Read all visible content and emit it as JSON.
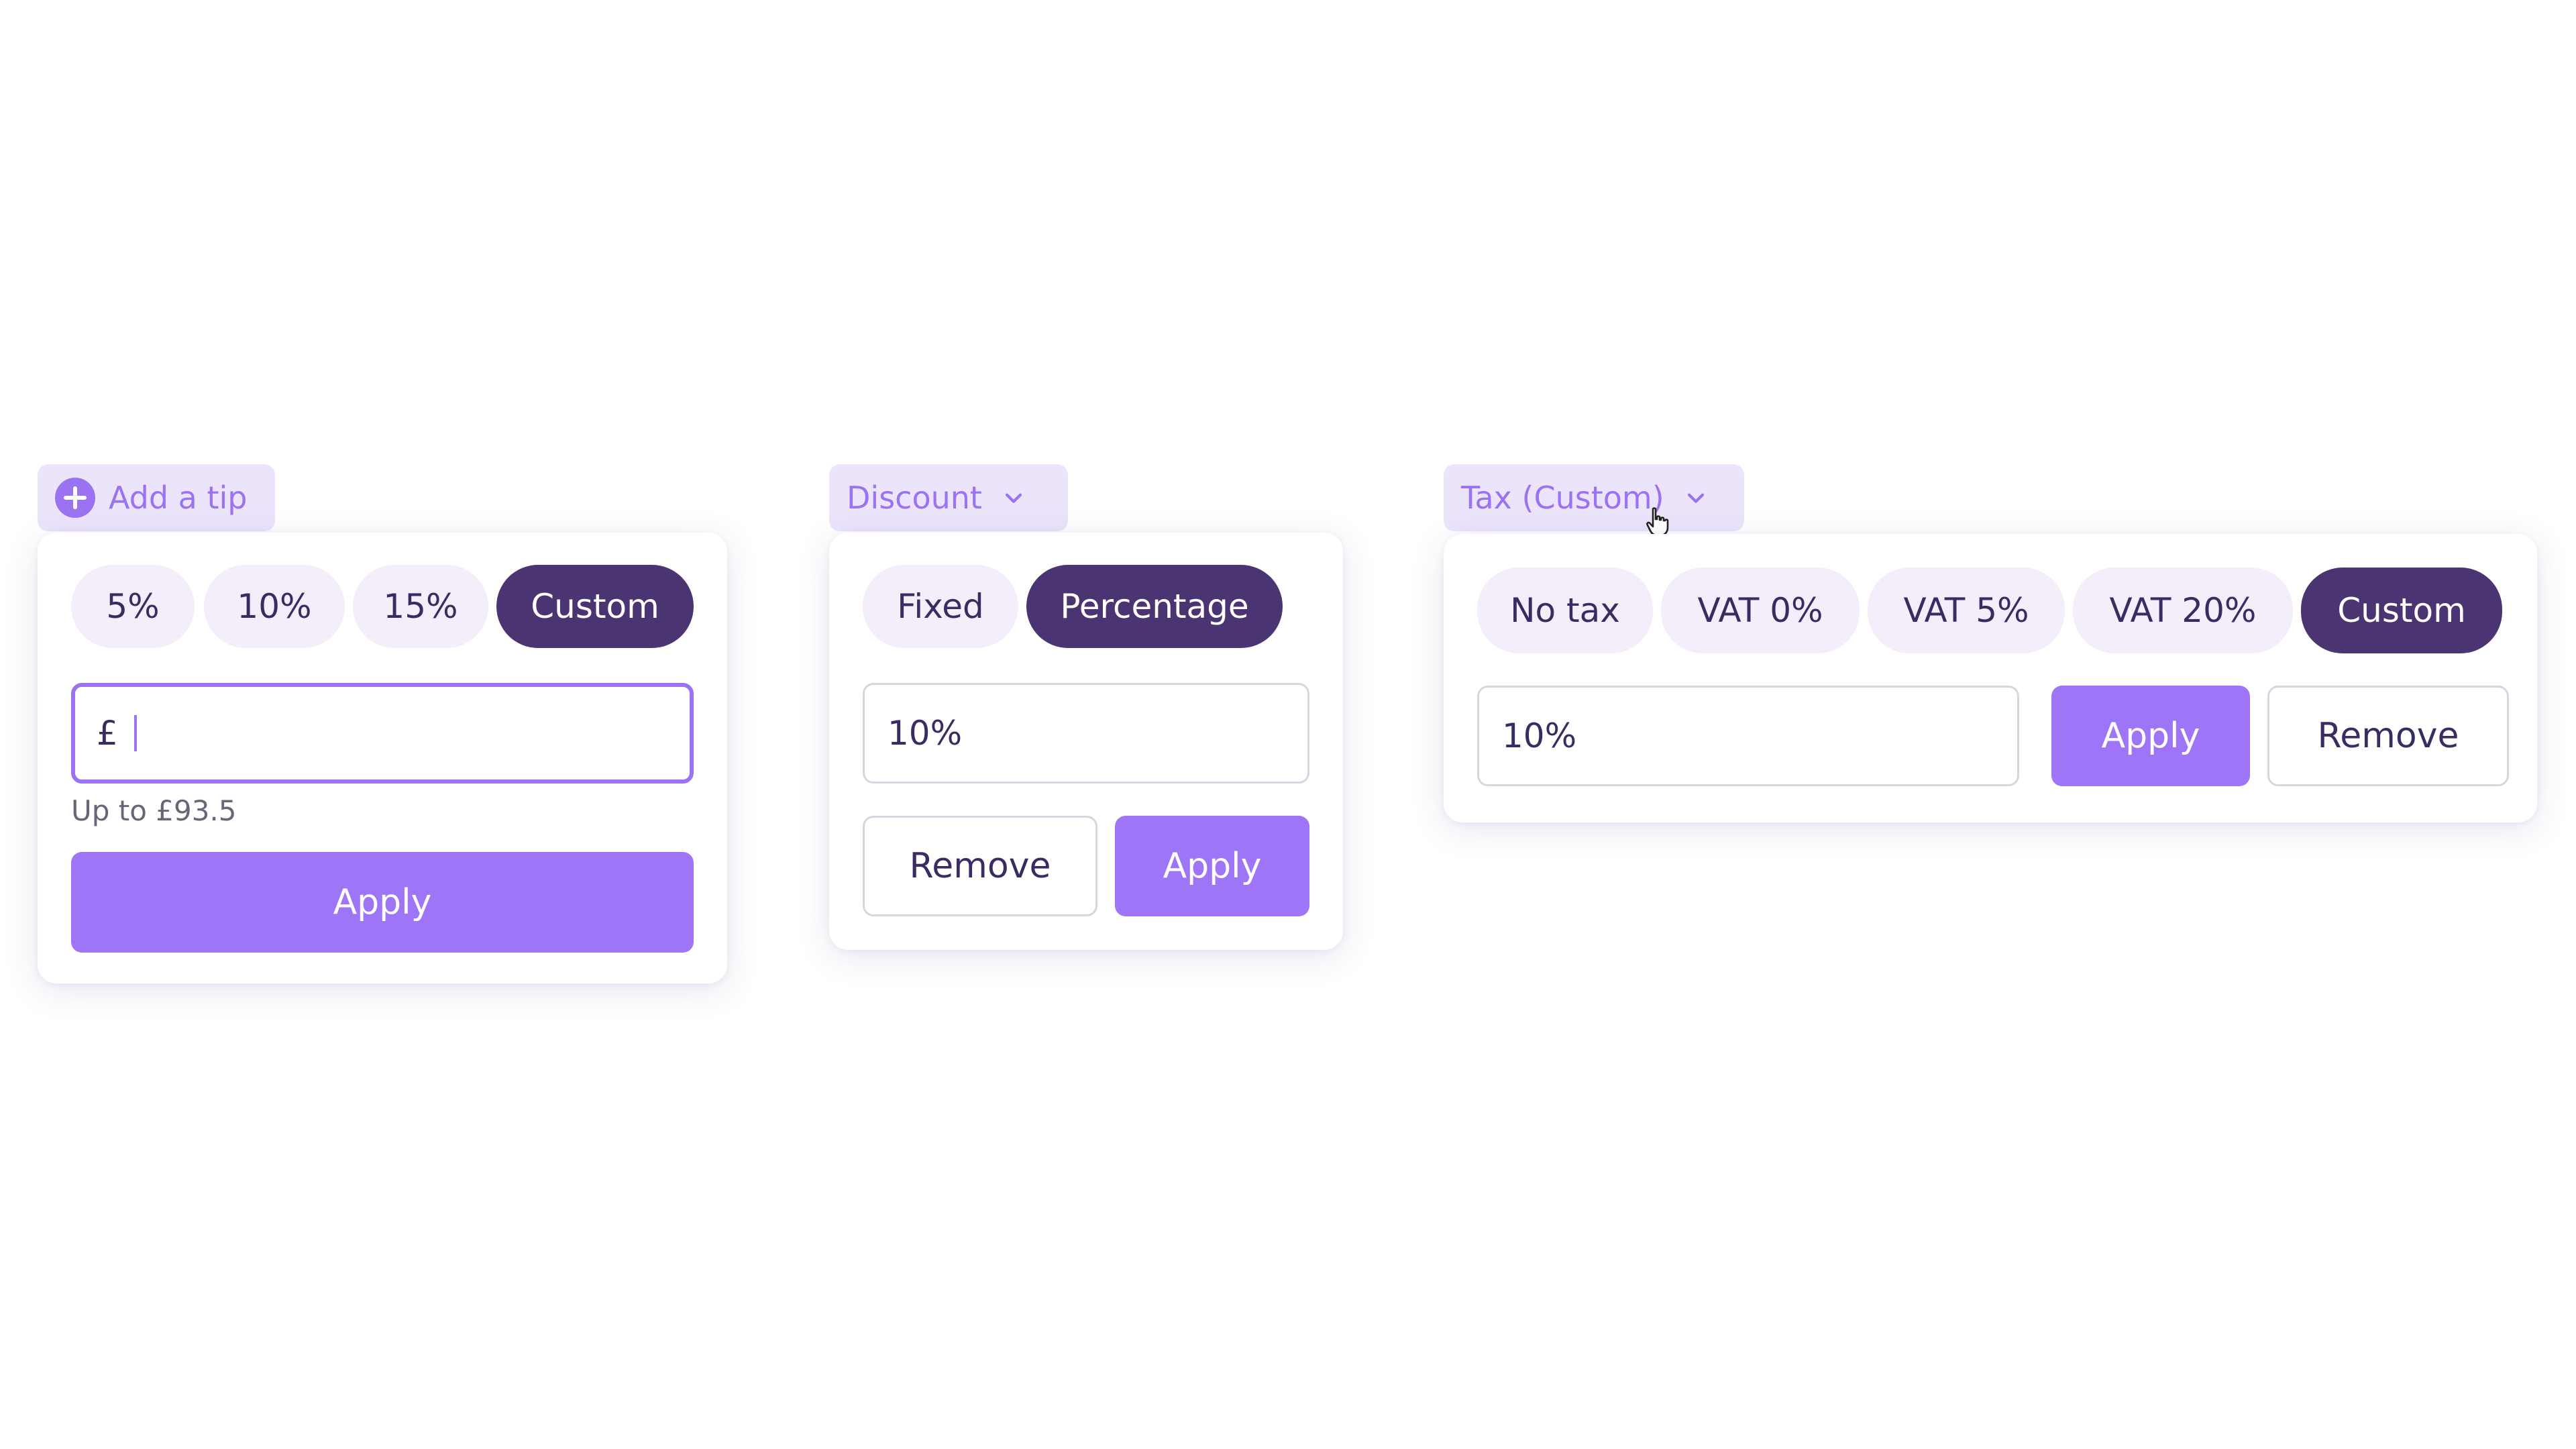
{
  "colors": {
    "accent": "#9e75f6",
    "accent_light": "#ece4fb",
    "selected_chip": "#4a3472",
    "chip_bg": "#f3eef9",
    "text": "#3b2b63"
  },
  "tip": {
    "trigger_label": "Add a tip",
    "trigger_icon": "plus-circle-icon",
    "options": [
      "5%",
      "10%",
      "15%",
      "Custom"
    ],
    "selected_option": "Custom",
    "currency_symbol": "£",
    "input_value": "",
    "helper_text": "Up to £93.5",
    "apply_label": "Apply"
  },
  "discount": {
    "trigger_label": "Discount",
    "trigger_icon": "chevron-down-icon",
    "options": [
      "Fixed",
      "Percentage"
    ],
    "selected_option": "Percentage",
    "input_value": "10%",
    "remove_label": "Remove",
    "apply_label": "Apply"
  },
  "tax": {
    "trigger_label": "Tax (Custom)",
    "trigger_icon": "chevron-down-icon",
    "options": [
      "No tax",
      "VAT 0%",
      "VAT 5%",
      "VAT 20%",
      "Custom"
    ],
    "selected_option": "Custom",
    "input_value": "10%",
    "apply_label": "Apply",
    "remove_label": "Remove"
  },
  "pointer_icon": "hand-pointer-icon"
}
